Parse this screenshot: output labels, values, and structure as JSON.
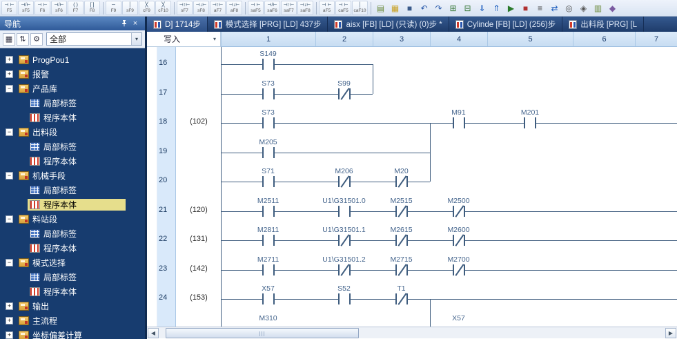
{
  "icons": {
    "dropdown": "▾",
    "scroll_left": "◀",
    "scroll_right": "▶",
    "close": "×",
    "expand": "+",
    "collapse": "−"
  },
  "toolbar": {
    "fkey_groups": [
      [
        {
          "sym": "⊣ ⊢",
          "key": "F5"
        },
        {
          "sym": "⊣/⊢",
          "key": "sF5"
        },
        {
          "sym": "⊣ ⊢",
          "key": "F6"
        },
        {
          "sym": "⊣/⊢",
          "key": "sF6"
        },
        {
          "sym": "( )",
          "key": "F7"
        },
        {
          "sym": "[ ]",
          "key": "F8"
        }
      ],
      [
        {
          "sym": "─",
          "key": "F9"
        },
        {
          "sym": "│",
          "key": "sF9"
        },
        {
          "sym": "╳",
          "key": "cF9"
        },
        {
          "sym": "╳",
          "key": "cF10"
        }
      ],
      [
        {
          "sym": "⊣↑⊢",
          "key": "sF7"
        },
        {
          "sym": "⊣↓⊢",
          "key": "sF8"
        },
        {
          "sym": "⊣↑⊢",
          "key": "aF7"
        },
        {
          "sym": "⊣↓⊢",
          "key": "aF8"
        }
      ],
      [
        {
          "sym": "⊣ ⊢",
          "key": "saF5"
        },
        {
          "sym": "⊣/⊢",
          "key": "saF6"
        },
        {
          "sym": "⊣↑⊢",
          "key": "saF7"
        },
        {
          "sym": "⊣↓⊢",
          "key": "saF8"
        }
      ],
      [
        {
          "sym": "⊣ ⊢",
          "key": "aF5"
        },
        {
          "sym": "⊣ ⊢",
          "key": "caF5"
        },
        {
          "sym": "│",
          "key": "caF10"
        }
      ]
    ],
    "action_icons": [
      {
        "name": "new-icon",
        "glyph": "▤",
        "color": "#6a8a3a"
      },
      {
        "name": "open-icon",
        "glyph": "▦",
        "color": "#c9a227"
      },
      {
        "name": "save-icon",
        "glyph": "■",
        "color": "#3a5a8a"
      },
      {
        "name": "undo-icon",
        "glyph": "↶",
        "color": "#2a5aaa"
      },
      {
        "name": "redo-icon",
        "glyph": "↷",
        "color": "#2a5aaa"
      },
      {
        "name": "convert-icon",
        "glyph": "⊞",
        "color": "#3a7a3a"
      },
      {
        "name": "convert-all-icon",
        "glyph": "⊟",
        "color": "#3a7a3a"
      },
      {
        "name": "write-to-plc-icon",
        "glyph": "⇓",
        "color": "#1f5fbf"
      },
      {
        "name": "read-from-plc-icon",
        "glyph": "⇑",
        "color": "#1f5fbf"
      },
      {
        "name": "monitor-start-icon",
        "glyph": "▶",
        "color": "#2a7a2a"
      },
      {
        "name": "monitor-stop-icon",
        "glyph": "■",
        "color": "#b03030"
      },
      {
        "name": "device-batch-monitor-icon",
        "glyph": "≡",
        "color": "#444444"
      },
      {
        "name": "cross-reference-icon",
        "glyph": "⇄",
        "color": "#1f5fbf"
      },
      {
        "name": "find-icon",
        "glyph": "◎",
        "color": "#555555"
      },
      {
        "name": "zoom-icon",
        "glyph": "◈",
        "color": "#555555"
      },
      {
        "name": "comment-display-icon",
        "glyph": "▥",
        "color": "#6a8a3a"
      },
      {
        "name": "options-icon",
        "glyph": "◆",
        "color": "#7a5aa0"
      }
    ]
  },
  "tabs": {
    "active_index": 0,
    "items": [
      {
        "label": "D] 1714步"
      },
      {
        "label": "模式选择 [PRG] [LD] 437步"
      },
      {
        "label": "aisx [FB] [LD] (只读) (0)步 *"
      },
      {
        "label": "Cylinde [FB] [LD] (256)步"
      },
      {
        "label": "出料段 [PRG] [L"
      }
    ]
  },
  "nav": {
    "title": "导航",
    "filter_value": "全部",
    "toolbar_icons": [
      {
        "name": "display-target-icon",
        "glyph": "▦"
      },
      {
        "name": "sort-icon",
        "glyph": "⇅"
      },
      {
        "name": "settings-gear-icon",
        "glyph": "⚙"
      }
    ],
    "tree": [
      {
        "label": "ProgPou1",
        "depth": 0,
        "icon": "pou",
        "exp": "plus"
      },
      {
        "label": "报警",
        "depth": 0,
        "icon": "pou",
        "exp": "plus"
      },
      {
        "label": "产品库",
        "depth": 0,
        "icon": "pou",
        "exp": "minus"
      },
      {
        "label": "局部标签",
        "depth": 1,
        "icon": "label"
      },
      {
        "label": "程序本体",
        "depth": 1,
        "icon": "body"
      },
      {
        "label": "出料段",
        "depth": 0,
        "icon": "pou",
        "exp": "minus"
      },
      {
        "label": "局部标签",
        "depth": 1,
        "icon": "label"
      },
      {
        "label": "程序本体",
        "depth": 1,
        "icon": "body"
      },
      {
        "label": "机械手段",
        "depth": 0,
        "icon": "pou",
        "exp": "minus"
      },
      {
        "label": "局部标签",
        "depth": 1,
        "icon": "label"
      },
      {
        "label": "程序本体",
        "depth": 1,
        "icon": "body",
        "selected": true
      },
      {
        "label": "料站段",
        "depth": 0,
        "icon": "pou",
        "exp": "minus"
      },
      {
        "label": "局部标签",
        "depth": 1,
        "icon": "label"
      },
      {
        "label": "程序本体",
        "depth": 1,
        "icon": "body"
      },
      {
        "label": "模式选择",
        "depth": 0,
        "icon": "pou",
        "exp": "minus"
      },
      {
        "label": "局部标签",
        "depth": 1,
        "icon": "label"
      },
      {
        "label": "程序本体",
        "depth": 1,
        "icon": "body"
      },
      {
        "label": "输出",
        "depth": 0,
        "icon": "pou",
        "exp": "plus"
      },
      {
        "label": "主流程",
        "depth": 0,
        "icon": "pou",
        "exp": "plus"
      },
      {
        "label": "坐标偏差计算",
        "depth": 0,
        "icon": "pou",
        "exp": "plus"
      }
    ]
  },
  "ladder": {
    "mode_label": "写入",
    "columns": [
      "1",
      "2",
      "3",
      "4",
      "5",
      "6",
      "7"
    ],
    "rows": [
      {
        "num": "16",
        "step": "",
        "line_to": 2,
        "contacts": [
          {
            "label": "S149",
            "col": 1
          }
        ]
      },
      {
        "num": "17",
        "step": "",
        "line_to": 2,
        "contacts": [
          {
            "label": "S73",
            "col": 1
          },
          {
            "label": "S99",
            "col": 2,
            "nc": true
          }
        ]
      },
      {
        "num": "18",
        "step": "(102)",
        "line_to": 7,
        "contacts": [
          {
            "label": "S73",
            "col": 1
          },
          {
            "label": "M91",
            "col": 4
          },
          {
            "label": "M201",
            "col": 5
          }
        ]
      },
      {
        "num": "19",
        "step": "",
        "line_to": 3,
        "contacts": [
          {
            "label": "M205",
            "col": 1
          }
        ]
      },
      {
        "num": "20",
        "step": "",
        "line_to": 3,
        "contacts": [
          {
            "label": "S71",
            "col": 1
          },
          {
            "label": "M206",
            "col": 2,
            "nc": true
          },
          {
            "label": "M20",
            "col": 3,
            "nc": true
          }
        ]
      },
      {
        "num": "21",
        "step": "(120)",
        "line_to": 7,
        "contacts": [
          {
            "label": "M2511",
            "col": 1
          },
          {
            "label": "U1\\G31501.0",
            "col": 2
          },
          {
            "label": "M2515",
            "col": 3,
            "nc": true
          },
          {
            "label": "M2500",
            "col": 4,
            "nc": true
          }
        ]
      },
      {
        "num": "22",
        "step": "(131)",
        "line_to": 7,
        "contacts": [
          {
            "label": "M2811",
            "col": 1
          },
          {
            "label": "U1\\G31501.1",
            "col": 2,
            "nc": true
          },
          {
            "label": "M2615",
            "col": 3,
            "nc": true
          },
          {
            "label": "M2600",
            "col": 4,
            "nc": true
          }
        ]
      },
      {
        "num": "23",
        "step": "(142)",
        "line_to": 7,
        "contacts": [
          {
            "label": "M2711",
            "col": 1
          },
          {
            "label": "U1\\G31501.2",
            "col": 2,
            "nc": true
          },
          {
            "label": "M2715",
            "col": 3,
            "nc": true
          },
          {
            "label": "M2700",
            "col": 4,
            "nc": true
          }
        ]
      },
      {
        "num": "24",
        "step": "(153)",
        "line_to": 7,
        "contacts": [
          {
            "label": "X57",
            "col": 1
          },
          {
            "label": "S52",
            "col": 2
          },
          {
            "label": "T1",
            "col": 3,
            "nc": true
          }
        ]
      },
      {
        "num": "",
        "step": "",
        "line_to": 0,
        "contacts": [
          {
            "label": "M310",
            "col": 1,
            "label_only": true
          },
          {
            "label": "X57",
            "col": 4,
            "label_only": true
          }
        ]
      }
    ],
    "branches": [
      {
        "col": 2,
        "from": 0,
        "to": 1
      },
      {
        "col": 3,
        "from": 2,
        "to": 4
      },
      {
        "col": 3,
        "from": 8,
        "to": 9
      }
    ]
  },
  "colors": {
    "selection_highlight": "#e6de8c",
    "nav_background": "#173c6f",
    "tab_bar_background": "#27497d",
    "active_tab": "#3a639f",
    "ladder_line": "#3e5c7e",
    "grid_header": "#d3e5f7",
    "row_number_column": "#d9e9fa"
  }
}
